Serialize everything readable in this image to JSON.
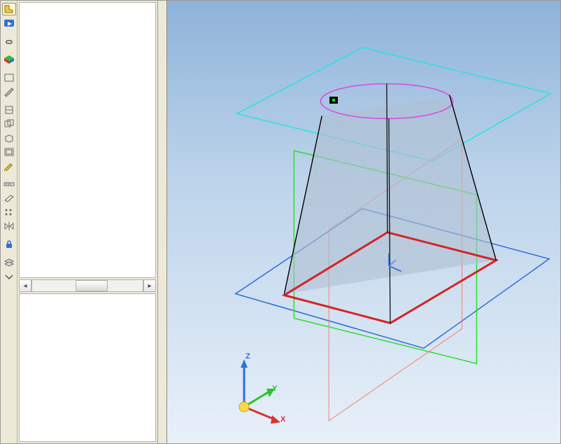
{
  "toolbar": {
    "items": [
      {
        "name": "tool-boot",
        "title": "Boot Tool"
      },
      {
        "name": "tool-playback",
        "title": "Playback"
      },
      {
        "name": "tool-link",
        "title": "Link"
      },
      {
        "name": "tool-rgb-cube",
        "title": "Datum CSYS"
      },
      {
        "name": "tool-geometry",
        "title": "Geometry"
      },
      {
        "name": "tool-sketch",
        "title": "Sketch"
      },
      {
        "name": "tool-feature-1",
        "title": "Feature"
      },
      {
        "name": "tool-feature-2",
        "title": "Feature"
      },
      {
        "name": "tool-extrude",
        "title": "Extrude"
      },
      {
        "name": "tool-shell",
        "title": "Shell"
      },
      {
        "name": "tool-pencil",
        "title": "Edit"
      },
      {
        "name": "tool-measure",
        "title": "Measure"
      },
      {
        "name": "tool-plane",
        "title": "Datum Plane"
      },
      {
        "name": "tool-pattern",
        "title": "Pattern"
      },
      {
        "name": "tool-mirror",
        "title": "Mirror"
      },
      {
        "name": "tool-lock",
        "title": "Lock"
      },
      {
        "name": "tool-layers",
        "title": "Layers"
      }
    ]
  },
  "viewport": {
    "axes": {
      "x": "X",
      "y": "Y",
      "z": "Z"
    },
    "origin_label": "",
    "colors": {
      "x_axis": "#d63434",
      "y_axis": "#2fbf2f",
      "z_axis": "#2f6fd6",
      "origin": "#f7d94a",
      "top_plane_edge": "#29e2e2",
      "bottom_plane_edge": "#2a6cd6",
      "side_plane_green": "#2adf2a",
      "side_plane_red": "#ff7a6a",
      "section_red": "#d42323",
      "top_ellipse": "#d64adf",
      "section_fill": "#b9c7d7"
    },
    "geometry_summary": "Truncated conical/pyramid body on an iso grid with three datum planes and an axis triad"
  }
}
